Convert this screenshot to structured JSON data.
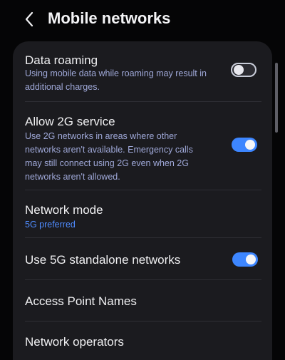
{
  "header": {
    "title": "Mobile networks",
    "back_icon": "chevron-left-icon"
  },
  "settings": {
    "data_roaming": {
      "label": "Data roaming",
      "desc_line1": "Using mobile data while roaming may result in",
      "desc_line2": "additional charges.",
      "enabled": false
    },
    "allow_2g": {
      "label": "Allow 2G service",
      "desc_line1": "Use 2G networks in areas where other",
      "desc_line2": "networks aren't available. Emergency calls",
      "desc_line3": "may still connect using 2G even when 2G",
      "desc_line4": "networks aren't allowed.",
      "enabled": true
    },
    "network_mode": {
      "label": "Network mode",
      "value": "5G preferred"
    },
    "standalone_5g": {
      "label": "Use 5G standalone networks",
      "enabled": true
    },
    "apn": {
      "label": "Access Point Names"
    },
    "operators": {
      "label": "Network operators"
    }
  },
  "colors": {
    "accent": "#3d86ff",
    "value_text": "#4f8cff",
    "description_text": "#9fa8d8",
    "card_bg": "#1b1b1f",
    "page_bg": "#050506"
  }
}
